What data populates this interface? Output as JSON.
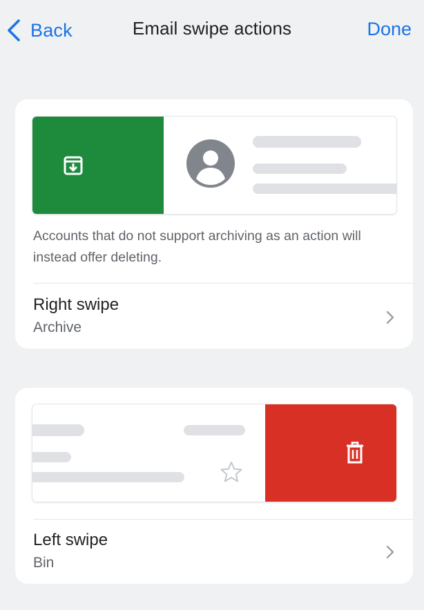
{
  "nav": {
    "back_label": "Back",
    "title": "Email swipe actions",
    "done_label": "Done"
  },
  "right_swipe": {
    "preview_action_icon": "archive-icon",
    "preview_action_color": "#1e8a3c",
    "note": "Accounts that do not support archiving as an action will instead offer deleting.",
    "title": "Right swipe",
    "value": "Archive"
  },
  "left_swipe": {
    "preview_action_icon": "trash-icon",
    "preview_action_color": "#d93025",
    "title": "Left swipe",
    "value": "Bin"
  },
  "colors": {
    "accent": "#1a73e8",
    "background": "#eff1f3",
    "placeholder": "#dfe1e5"
  }
}
